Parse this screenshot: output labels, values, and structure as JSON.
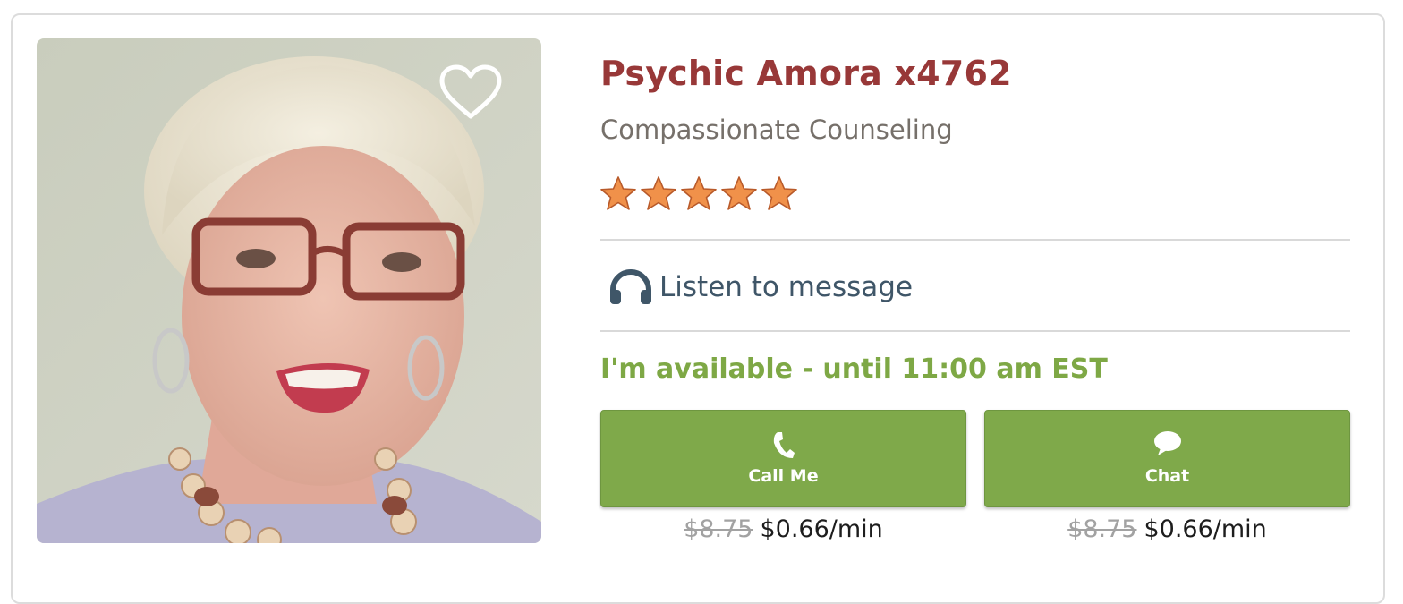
{
  "advisor": {
    "name": "Psychic Amora x4762",
    "tagline": "Compassionate Counseling",
    "rating_stars": 5,
    "rating_max": 5
  },
  "listen": {
    "label": "Listen to message",
    "icon": "headphones-icon"
  },
  "availability": {
    "text": "I'm available - until 11:00 am EST",
    "color": "#7ea845"
  },
  "actions": [
    {
      "label": "Call Me",
      "icon": "phone-icon",
      "old_price": "$8.75",
      "price": "$0.66/min"
    },
    {
      "label": "Chat",
      "icon": "chat-bubble-icon",
      "old_price": "$8.75",
      "price": "$0.66/min"
    }
  ],
  "colors": {
    "name": "#983838",
    "button": "#7fa94a",
    "star": "#f0914a"
  }
}
